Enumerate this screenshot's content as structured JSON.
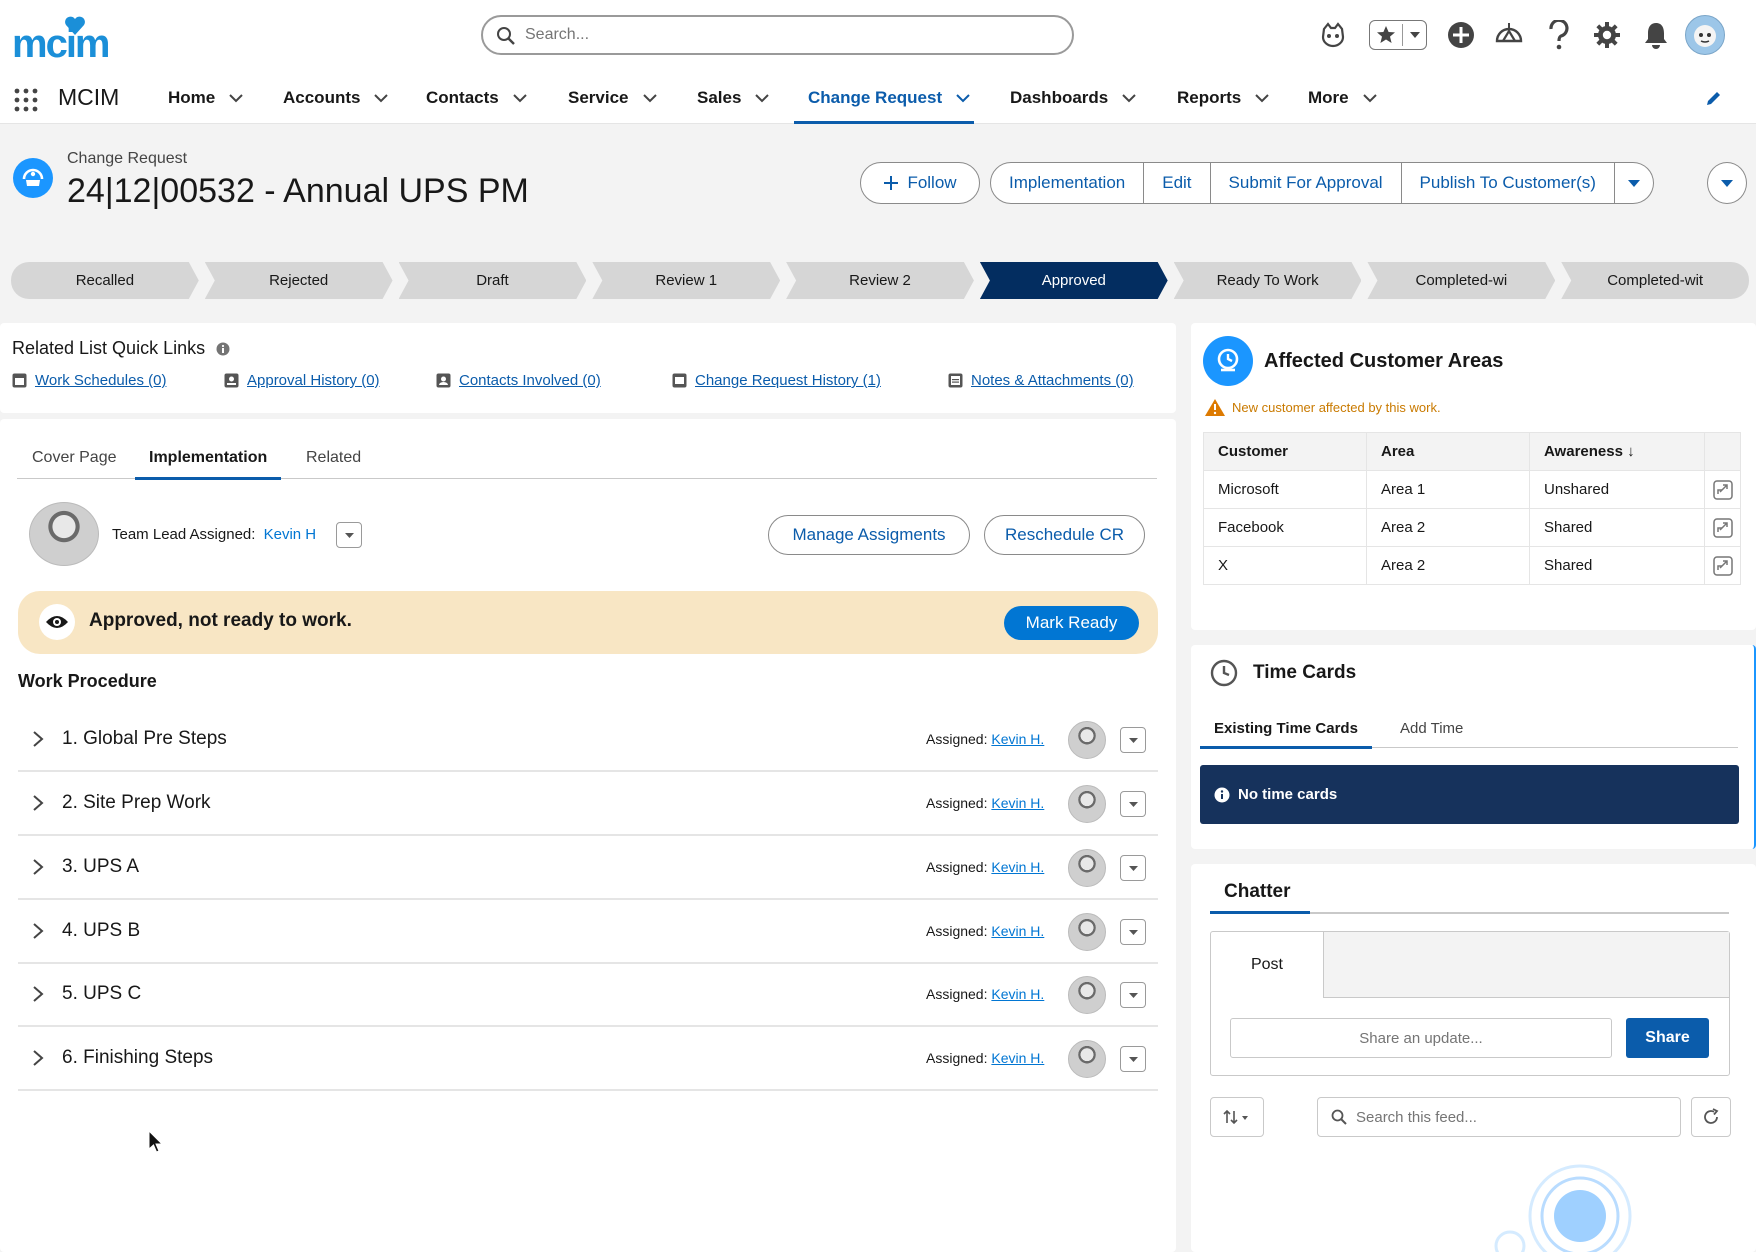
{
  "brand": {
    "logo_text": "mcim",
    "app_name": "MCIM",
    "accent": "#0b5cab"
  },
  "search": {
    "placeholder": "Search..."
  },
  "nav": {
    "items": [
      {
        "label": "Home"
      },
      {
        "label": "Accounts"
      },
      {
        "label": "Contacts"
      },
      {
        "label": "Service"
      },
      {
        "label": "Sales"
      },
      {
        "label": "Change Request",
        "active": true
      },
      {
        "label": "Dashboards"
      },
      {
        "label": "Reports"
      },
      {
        "label": "More"
      }
    ]
  },
  "record": {
    "object_type": "Change Request",
    "title": "24|12|00532 - Annual UPS PM",
    "follow_label": "Follow",
    "actions": [
      "Implementation",
      "Edit",
      "Submit For Approval",
      "Publish To Customer(s)"
    ]
  },
  "path": {
    "steps": [
      "Recalled",
      "Rejected",
      "Draft",
      "Review 1",
      "Review 2",
      "Approved",
      "Ready To Work",
      "Completed-wi",
      "Completed-wit"
    ],
    "current": "Approved",
    "current_color": "#032d60"
  },
  "quick_links": {
    "title": "Related List Quick Links",
    "links": [
      "Work Schedules (0)",
      "Approval History (0)",
      "Contacts Involved (0)",
      "Change Request History (1)",
      "Notes & Attachments (0)"
    ]
  },
  "tabs": {
    "items": [
      "Cover Page",
      "Implementation",
      "Related"
    ],
    "active": "Implementation"
  },
  "team_lead": {
    "label": "Team Lead Assigned:",
    "name": "Kevin H"
  },
  "buttons": {
    "manage": "Manage Assigments",
    "reschedule": "Reschedule CR"
  },
  "status_banner": {
    "message": "Approved, not ready to work.",
    "action": "Mark Ready",
    "bg": "#f8e6c4"
  },
  "work_procedure": {
    "title": "Work Procedure",
    "assigned_label": "Assigned:",
    "steps": [
      {
        "label": "1. Global Pre Steps",
        "assignee": "Kevin H."
      },
      {
        "label": "2. Site Prep Work",
        "assignee": "Kevin H."
      },
      {
        "label": "3. UPS A",
        "assignee": "Kevin H."
      },
      {
        "label": "4. UPS B",
        "assignee": "Kevin H."
      },
      {
        "label": "5. UPS C",
        "assignee": "Kevin H."
      },
      {
        "label": "6. Finishing Steps",
        "assignee": "Kevin H."
      }
    ]
  },
  "affected": {
    "title": "Affected Customer Areas",
    "notice": "New customer affected by this work.",
    "columns": [
      "Customer",
      "Area",
      "Awareness"
    ],
    "rows": [
      {
        "customer": "Microsoft",
        "area": "Area 1",
        "awareness": "Unshared"
      },
      {
        "customer": "Facebook",
        "area": "Area 2",
        "awareness": "Shared"
      },
      {
        "customer": "X",
        "area": "Area 2",
        "awareness": "Shared"
      }
    ]
  },
  "time_cards": {
    "title": "Time Cards",
    "tabs": [
      "Existing Time Cards",
      "Add Time"
    ],
    "empty": "No time cards"
  },
  "chatter": {
    "title": "Chatter",
    "post_tab": "Post",
    "share_placeholder": "Share an update...",
    "share_button": "Share",
    "feed_search_placeholder": "Search this feed..."
  }
}
